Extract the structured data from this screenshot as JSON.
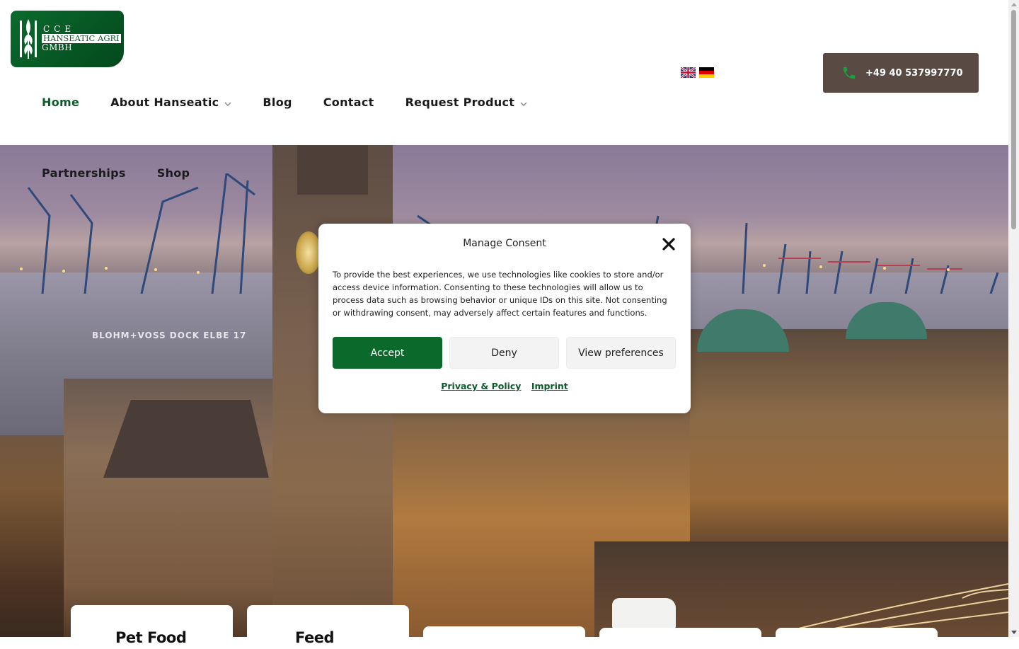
{
  "header": {
    "logo": {
      "line1": "CCE",
      "line2": "HANSEATIC AGRI",
      "line3": "GMBH",
      "icon": "wheat-icon"
    },
    "languages": [
      {
        "code": "en",
        "icon": "uk-flag-icon"
      },
      {
        "code": "de",
        "icon": "german-flag-icon"
      }
    ],
    "phone": {
      "label": "+49 40 537997770",
      "icon": "phone-icon"
    }
  },
  "nav": {
    "items": [
      {
        "label": "Home",
        "active": true
      },
      {
        "label": "About Hanseatic",
        "has_dropdown": true
      },
      {
        "label": "Blog"
      },
      {
        "label": "Contact"
      },
      {
        "label": "Request Product",
        "has_dropdown": true
      },
      {
        "label": "Partnerships"
      },
      {
        "label": "Shop"
      }
    ]
  },
  "hero": {
    "dock_sign": "BLOHM+VOSS DOCK ELBE 17"
  },
  "cards": [
    {
      "title": "Pet Food"
    },
    {
      "title": "Feed"
    },
    {
      "title": ""
    },
    {
      "title": ""
    },
    {
      "title": ""
    }
  ],
  "consent": {
    "title": "Manage Consent",
    "body": "To provide the best experiences, we use technologies like cookies to store and/or access device information. Consenting to these technologies will allow us to process data such as browsing behavior or unique IDs on this site. Not consenting or withdrawing consent, may adversely affect certain features and functions.",
    "accept": "Accept",
    "deny": "Deny",
    "preferences": "View preferences",
    "links": [
      "Privacy & Policy",
      "Imprint"
    ]
  },
  "colors": {
    "brand_green": "#0b6a2b",
    "phone_button": "#594a44",
    "nav_active": "#0b5c2a"
  }
}
